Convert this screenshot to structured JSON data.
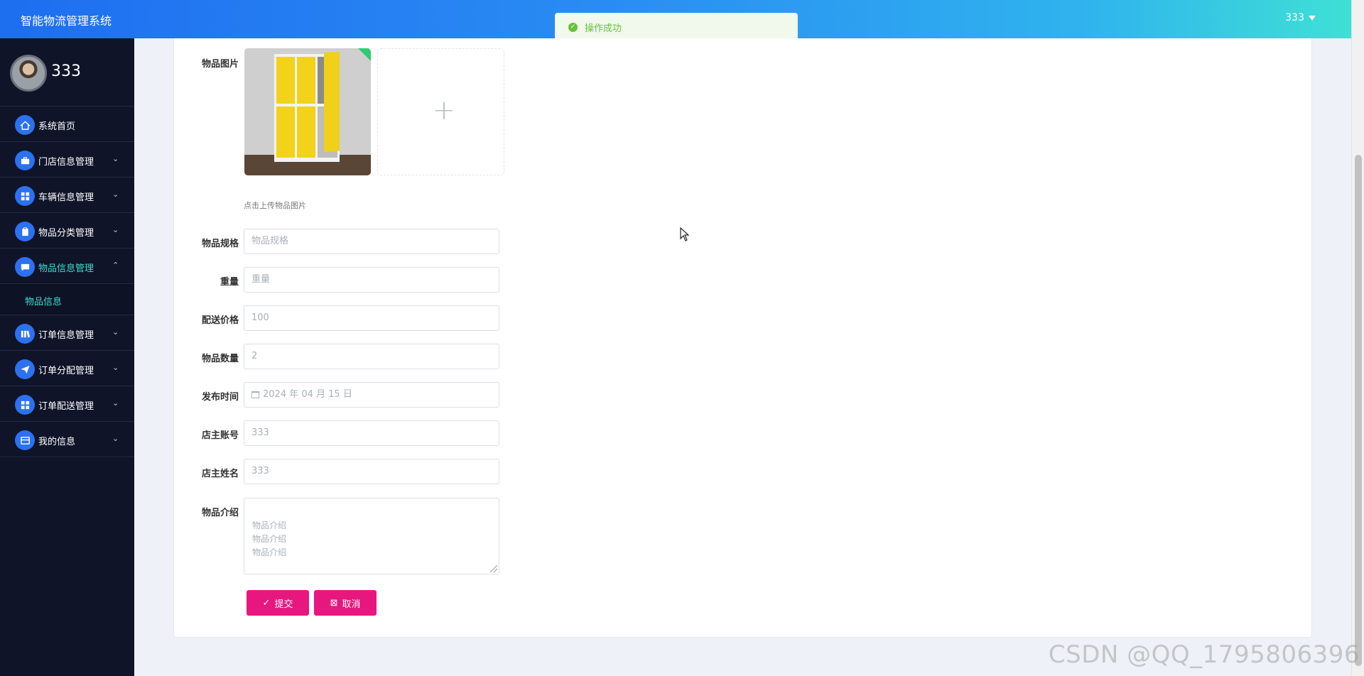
{
  "header": {
    "app_title": "智能物流管理系统",
    "user_menu_label": "333"
  },
  "toast": {
    "message": "操作成功",
    "status_color": "#67c23a"
  },
  "sidebar": {
    "username": "333",
    "items": [
      {
        "label": "系统首页",
        "icon": "home-icon",
        "has_chevron": false
      },
      {
        "label": "门店信息管理",
        "icon": "briefcase-icon",
        "chevron": "⌄"
      },
      {
        "label": "车辆信息管理",
        "icon": "grid-icon",
        "chevron": "⌄"
      },
      {
        "label": "物品分类管理",
        "icon": "clipboard-icon",
        "chevron": "⌄"
      },
      {
        "label": "物品信息管理",
        "icon": "message-icon",
        "chevron": "⌃",
        "active": true
      },
      {
        "label": "订单信息管理",
        "icon": "library-icon",
        "chevron": "⌄"
      },
      {
        "label": "订单分配管理",
        "icon": "send-icon",
        "chevron": "⌄"
      },
      {
        "label": "订单配送管理",
        "icon": "grid-icon",
        "chevron": "⌄"
      },
      {
        "label": "我的信息",
        "icon": "card-icon",
        "chevron": "⌄"
      }
    ],
    "submenu": {
      "label": "物品信息"
    }
  },
  "form": {
    "image": {
      "label": "物品图片",
      "hint": "点击上传物品图片",
      "add_symbol": "+"
    },
    "spec": {
      "label": "物品规格",
      "placeholder": "物品规格"
    },
    "weight": {
      "label": "重量",
      "placeholder": "重量"
    },
    "price": {
      "label": "配送价格",
      "value": "100"
    },
    "quantity": {
      "label": "物品数量",
      "value": "2"
    },
    "publish_time": {
      "label": "发布时间",
      "value": "2024 年 04 月 15 日"
    },
    "owner_account": {
      "label": "店主账号",
      "value": "333"
    },
    "owner_name": {
      "label": "店主姓名",
      "value": "333"
    },
    "intro": {
      "label": "物品介绍",
      "value": "物品介绍\n物品介绍\n物品介绍"
    },
    "submit_label": "提交",
    "cancel_label": "取消"
  },
  "watermark": "CSDN @QQ_1795806396",
  "colors": {
    "sidebar_bg": "#0f1429",
    "accent": "#3fdcd0",
    "button": "#e8167f",
    "icon_bg": "#2b71f0"
  }
}
